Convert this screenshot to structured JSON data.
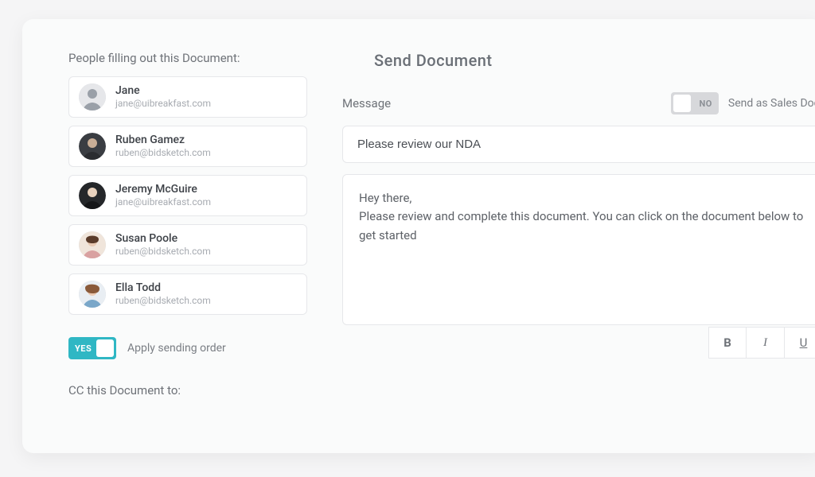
{
  "title": "Send Document",
  "left": {
    "people_label": "People filling out this Document:",
    "people": [
      {
        "name": "Jane",
        "email": "jane@uibreakfast.com",
        "avatar": "m1"
      },
      {
        "name": "Ruben Gamez",
        "email": "ruben@bidsketch.com",
        "avatar": "m2"
      },
      {
        "name": "Jeremy McGuire",
        "email": "jane@uibreakfast.com",
        "avatar": "m3"
      },
      {
        "name": "Susan Poole",
        "email": "ruben@bidsketch.com",
        "avatar": "f1"
      },
      {
        "name": "Ella Todd",
        "email": "ruben@bidsketch.com",
        "avatar": "f2"
      }
    ],
    "order_toggle": {
      "state": "YES",
      "label": "Apply sending order"
    },
    "cc_label": "CC this Document to:"
  },
  "right": {
    "message_label": "Message",
    "sales_toggle": {
      "state": "NO",
      "label": "Send as Sales Doc"
    },
    "subject": "Please review our NDA",
    "body": "Hey there,\nPlease review and complete this document. You can click on the document below to get started",
    "format": {
      "bold": "B",
      "italic": "I",
      "underline": "U"
    }
  }
}
